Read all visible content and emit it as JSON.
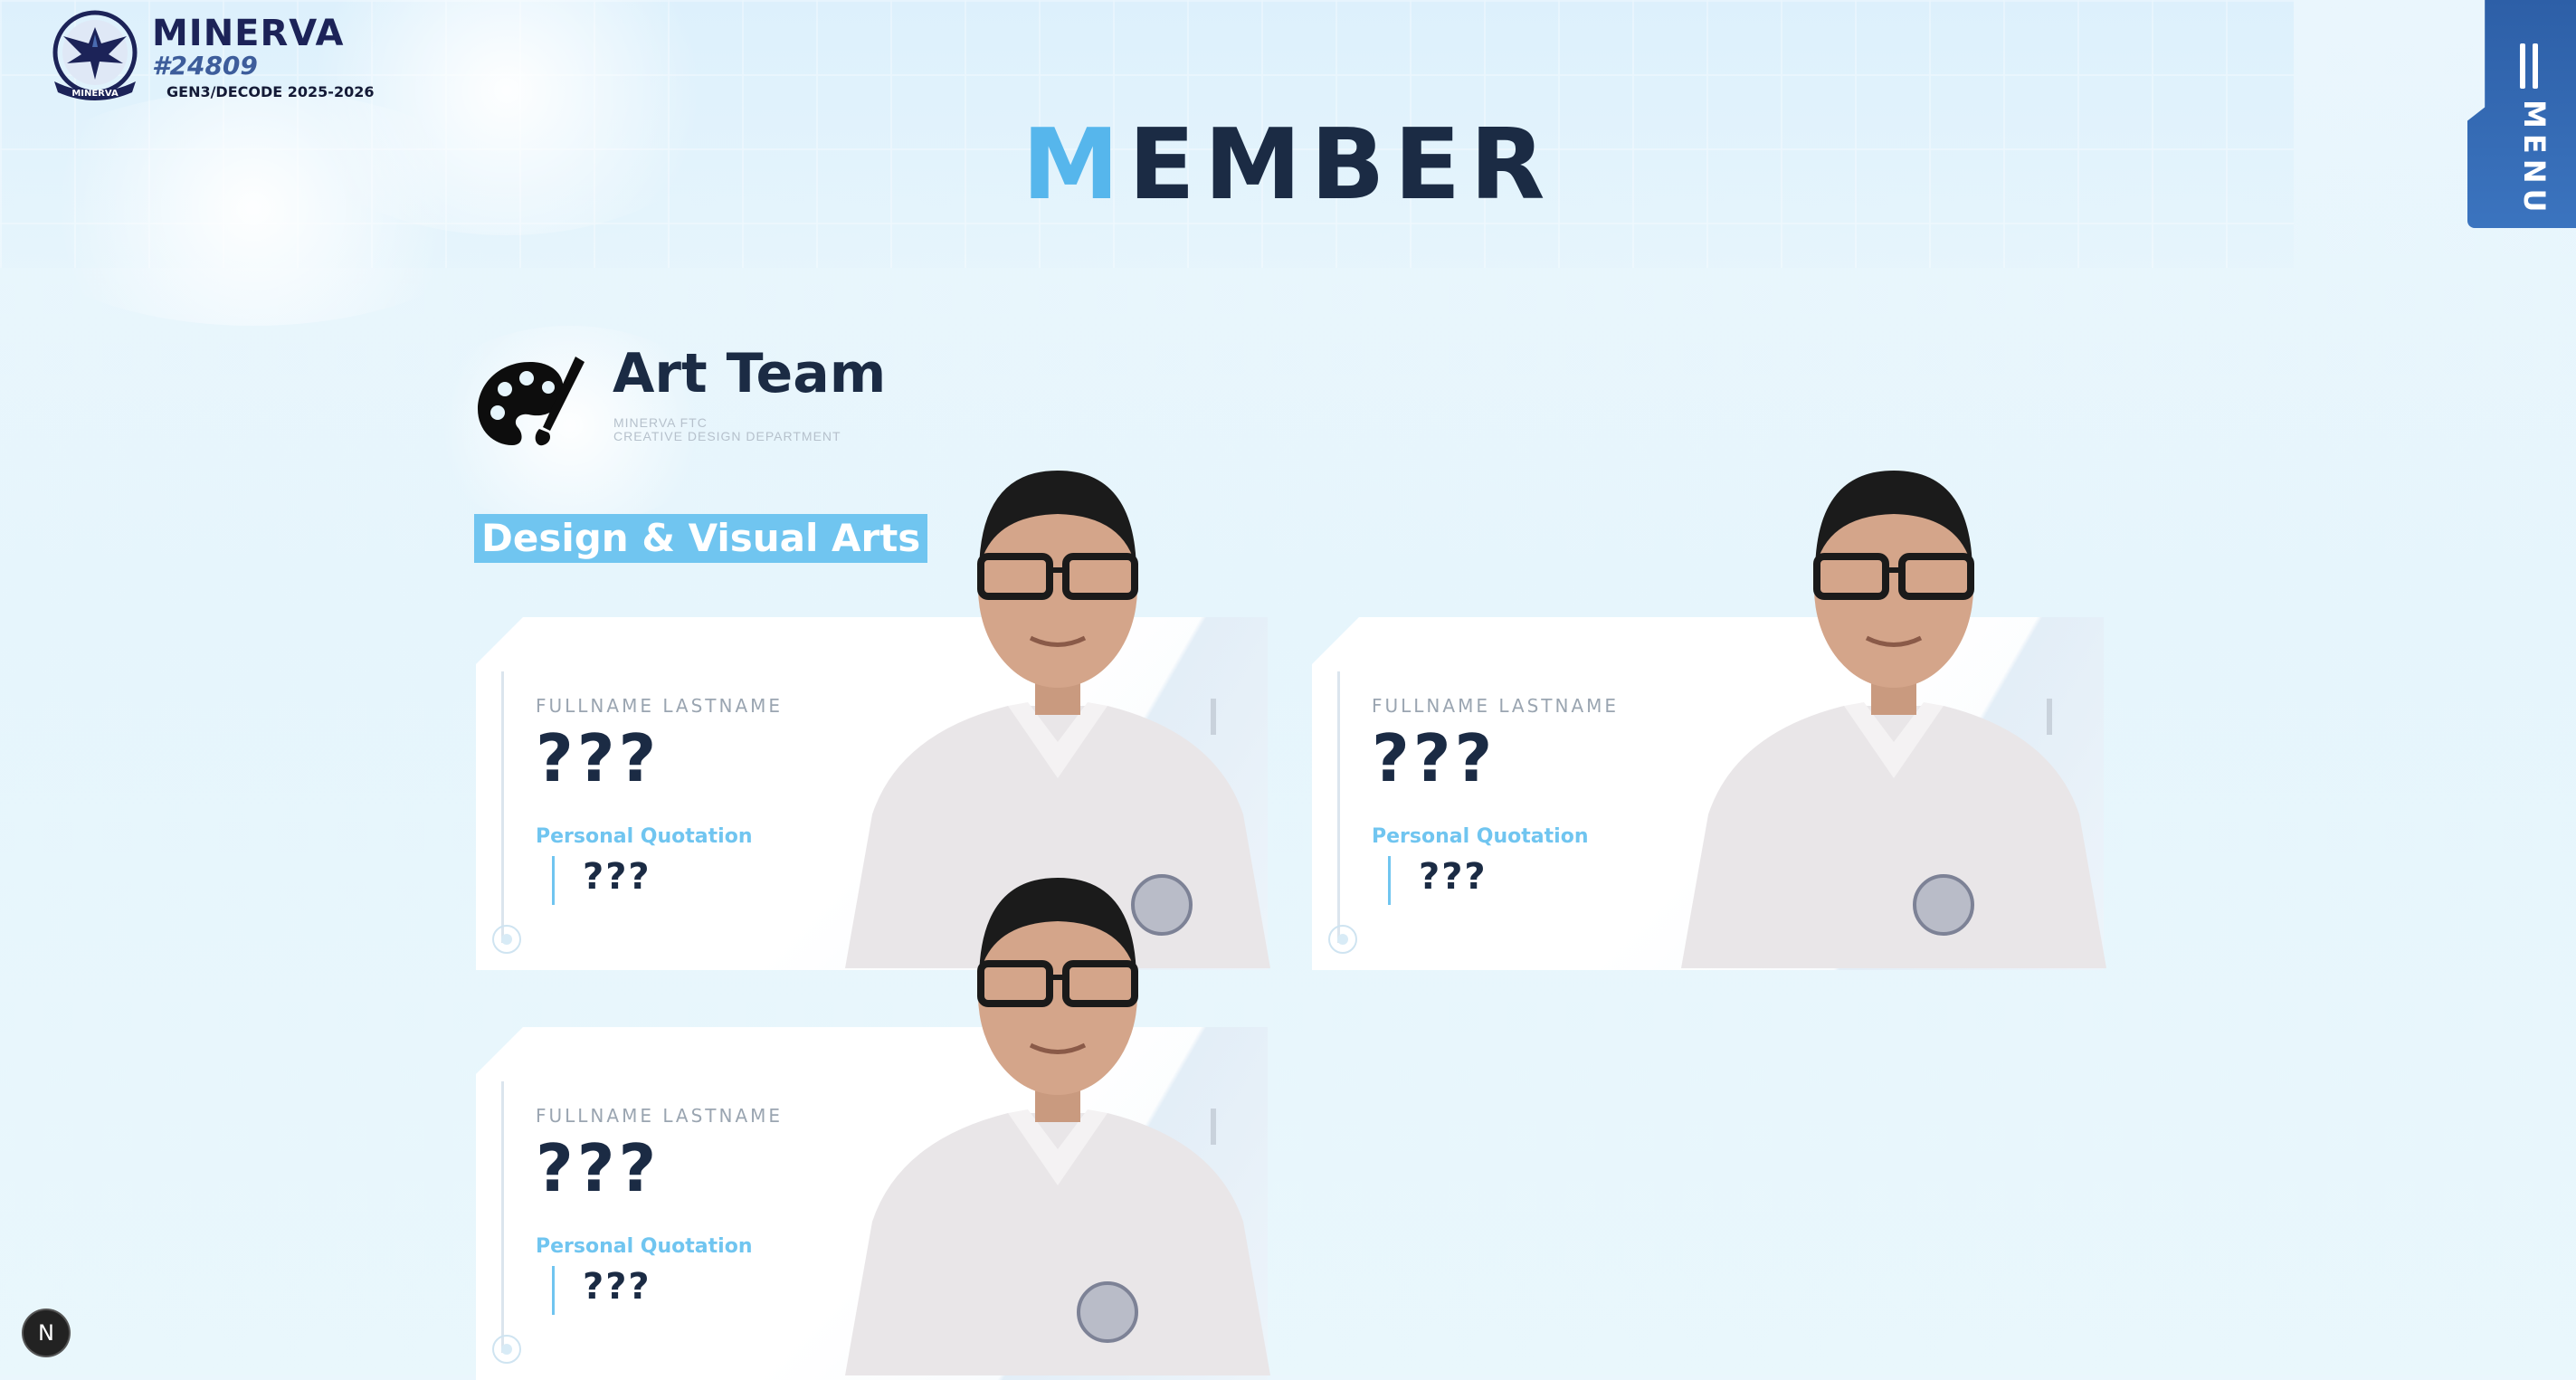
{
  "logo": {
    "title": "MINERVA",
    "number": "#24809",
    "subtitle": "GEN3/DECODE 2025-2026",
    "emblem_icon": "eagle-emblem-icon",
    "emblem_text": "MINERVA"
  },
  "menu": {
    "label": "MENU",
    "icon": "menu-lines-icon"
  },
  "page": {
    "title_accent": "M",
    "title_rest": "EMBER"
  },
  "team": {
    "icon": "palette-brush-icon",
    "name": "Art Team",
    "org_line1": "MINERVA FTC",
    "org_line2": "CREATIVE DESIGN DEPARTMENT",
    "section": "Design & Visual Arts"
  },
  "members": [
    {
      "name_caption": "FULLNAME LASTNAME",
      "name": "???",
      "quote_label": "Personal Quotation",
      "quote": "???"
    },
    {
      "name_caption": "FULLNAME LASTNAME",
      "name": "???",
      "quote_label": "Personal Quotation",
      "quote": "???"
    },
    {
      "name_caption": "FULLNAME LASTNAME",
      "name": "???",
      "quote_label": "Personal Quotation",
      "quote": "???"
    }
  ],
  "next_badge": {
    "label": "N"
  },
  "colors": {
    "accent": "#56b6ec",
    "dark": "#1b2b44",
    "menu": "#3468b2",
    "badge": "#70c5f0"
  }
}
